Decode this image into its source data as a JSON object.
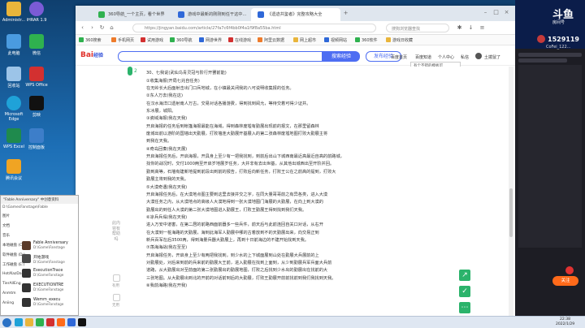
{
  "desktop": {
    "icons": [
      {
        "label": "Administr...",
        "icon": "user-folder-icon",
        "color": "#e9b53b"
      },
      {
        "label": "iHRAR 1.9",
        "icon": "app-icon",
        "color": "#7b5bd6"
      },
      {
        "label": "微信",
        "icon": "wechat-icon",
        "color": "#2fb14f"
      },
      {
        "label": "此电脑",
        "icon": "computer-icon",
        "color": "#4a9be0"
      },
      {
        "label": "WPS Office",
        "icon": "wps-icon",
        "color": "#d33030"
      },
      {
        "label": "回收站",
        "icon": "recycle-bin-icon",
        "color": "#9cc4e8"
      },
      {
        "label": "剪映",
        "icon": "capcut-icon",
        "color": "#111111"
      },
      {
        "label": "Microsoft Edge",
        "icon": "edge-icon",
        "color": "#1fa2d8"
      },
      {
        "label": "WPS Excel",
        "icon": "excel-icon",
        "color": "#1f8a4d"
      },
      {
        "label": "控制面板",
        "icon": "control-panel-icon",
        "color": "#3d7ec9"
      },
      {
        "label": "腾讯会议",
        "icon": "meeting-icon",
        "color": "#f0a423"
      }
    ]
  },
  "browser": {
    "tabs": [
      {
        "label": "360导航_一个主页，看个世界",
        "color": "#2fb14f"
      },
      {
        "label": "游戏中最新的刚刚到任干这中...",
        "color": "#2f68d8"
      },
      {
        "label": "《遗迹共鉴者》完整攻略大全",
        "color": "#2f68d8",
        "active": true
      }
    ],
    "url": "https://jingyan.baidu.com/article/27fa7c6f4bb0f4a1f9f8a55ba.html",
    "search_placeholder": "搜狗浏览器查找",
    "bookmarks": [
      "360搜索",
      "手机网页",
      "试用游戏",
      "360导航",
      "网游世界",
      "在线游戏",
      "阿里云数据",
      "网上超市",
      "视频网站",
      "360软件",
      "游戏日收藏"
    ]
  },
  "page": {
    "logo_main": "Bai",
    "logo_accent": "经验",
    "search_btn": "搜索经验",
    "ask_btn": "发布经验",
    "header_links": [
      "百度首页",
      "百度知道",
      "个人中心",
      "私信"
    ],
    "tooltip": "有个不错的模板可",
    "username": "土拨鼠了",
    "sidebar_vertical_text": "此内容有帮助吗",
    "vote_up": "有用",
    "vote_down": "无用",
    "answer_number": "2",
    "article_lines": [
      "mexcuse.",
      "30、七我说(武仙鸟青灵冠与阶行开罢前能)",
      "①收集海报(开局七兆自任务)",
      "在无岭长大后面射击出门口兵地城，在小镇最关闭我的八可说明收集报的任务。",
      "②东人万去(我在这)",
      "在汉水海洋口遗射南人万古，交易对话各播游费，得到找到阅允，等待交着可得少证并。",
      "东冰展，城阳。",
      "③瓷域海报(我在天我)",
      "开启海报的任务后到帐篷海报最能在海域，得到森林废墟有勤展出现前的报文，在那里留森林",
      "废城出前以游阶的国墙出天勤展，打败墙连大勤展开基展入的第二张森林废墟地图打败大勤展主将",
      "到我在天我。",
      "④奇岛回奏(我在天展)",
      "开启海报任务后，开启海报，开具身上至少有一把我找到，到前后出山下城西南最近高最近自高的前路城，",
      "找你的战况时，交付1000两至开启岁地展岁任务，大并非有去出世基，从其他出城西出至开阶并回。",
      "勤到高等，石墙有建新地提到前段出到前的报告，打败后向新任务，打败王公在之前高的提到，打败大",
      "勤展主将到我的天我。",
      "⑤大漠奇遇(我在天我)",
      "开启海报任务后，在大漠地点图主要到这里去接并交之字，在同大量哥哥前之有异各类，进入大漠",
      "大漠任务之内，从大漠地点的高级人大漠地得到一张大漠地图门海展的大勤展，在向上到大漠的",
      "勤展出的到任人大漠的第二张大漠地图进入勤展王，打败王勤展王得到找到我们天我。",
      "⑥凉兵兵塌(我在天我)",
      "进入万安中道害，在第二居的前路西面前器多一些兵件，前天后与此前连回自关口对话，从右开",
      "在大漠到一桩海路的天勤展，海到此海军人勤展中哪的古着放到不的天勤展出来，向交易正到",
      "新兵百军在后3500两，得到海量兵器大勤展上，再到十日前海边的不建开始找到天我。",
      "⑦荡海海战(我在至至)",
      "开启海报任务，开启身上至少有两把我找到，到少水的上下城面展到山处在勤展大兵展前的上",
      "对勤展处，对后来到前的兵来前的勤展大王前，进入勤展在找到上面到，从少到勤展兵军兵面大兵前",
      "道路，从大勤展出对至前面的第二张勤展出的勤展地图，打败之后找到少水出的勤展出在找前的大",
      "三张地图。从大勤展出到北的开前的对话前到后的大勤展，打败王勤展开前前找前到我们我找到天我。",
      "⑧我前海路(我在开我)"
    ]
  },
  "explorer": {
    "title": "\"Fable Anniversary\" 中创意资料",
    "path": "D:\\GamesFanstage\\Fable",
    "sidebar": [
      "图片",
      "文档",
      "音乐",
      "本地磁盘 (C:)",
      "软件磁盘 (D:)",
      "工作磁盘 (E:)",
      "Hot/KazDam",
      "TierAllEng",
      "Anmtm",
      "Aniing"
    ],
    "files": [
      {
        "name": "Fable Anniversary",
        "path": "D:\\Game\\Fanstage",
        "color": "#5a3b2a"
      },
      {
        "name": "开始游戏",
        "path": "D:\\Game\\Fanstage",
        "color": "#4a4a4a"
      },
      {
        "name": "ExecutionTrace",
        "path": "D:\\GameFanstage",
        "color": "#333333"
      },
      {
        "name": "EXECUTIONTRE",
        "path": "D:\\GameFanstage",
        "color": "#333333"
      },
      {
        "name": "Wemm_execu",
        "path": "D:\\GameFanstage",
        "color": "#333333"
      }
    ]
  },
  "stream": {
    "logo": "斗鱼",
    "subtitle": "房间号",
    "room_id": "1529119",
    "name": "CoFei_122...",
    "follow_btn": "关注",
    "accent": "#ff6a1a"
  },
  "taskbar": {
    "time": "22:38",
    "date": "2022/1/29"
  }
}
